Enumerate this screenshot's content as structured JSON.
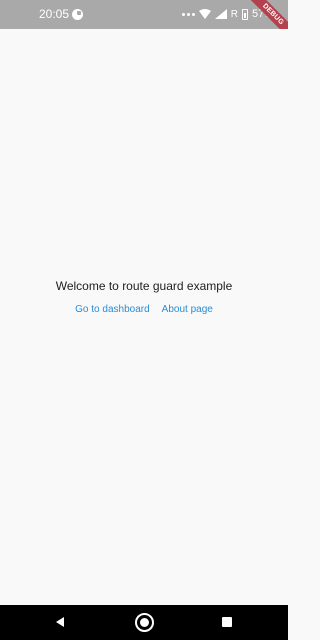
{
  "status_bar": {
    "time": "20:05",
    "icons": [
      "app-notification-icon",
      "more-dots-icon",
      "wifi-icon",
      "signal-icon",
      "battery-icon"
    ],
    "roaming_label": "R",
    "battery_percent": "57%"
  },
  "debug_banner": "DEBUG",
  "main": {
    "welcome_text": "Welcome to route guard example",
    "links": {
      "dashboard_label": "Go to dashboard",
      "about_label": "About page"
    }
  },
  "nav_bar": {
    "icons": [
      "back-icon",
      "home-icon",
      "recents-icon"
    ]
  },
  "colors": {
    "status_bar_bg": "#a9a9a9",
    "content_bg": "#f8f9f8",
    "link": "#2a8dd6",
    "debug_banner": "#b4424e",
    "nav_bar_bg": "#000000"
  }
}
